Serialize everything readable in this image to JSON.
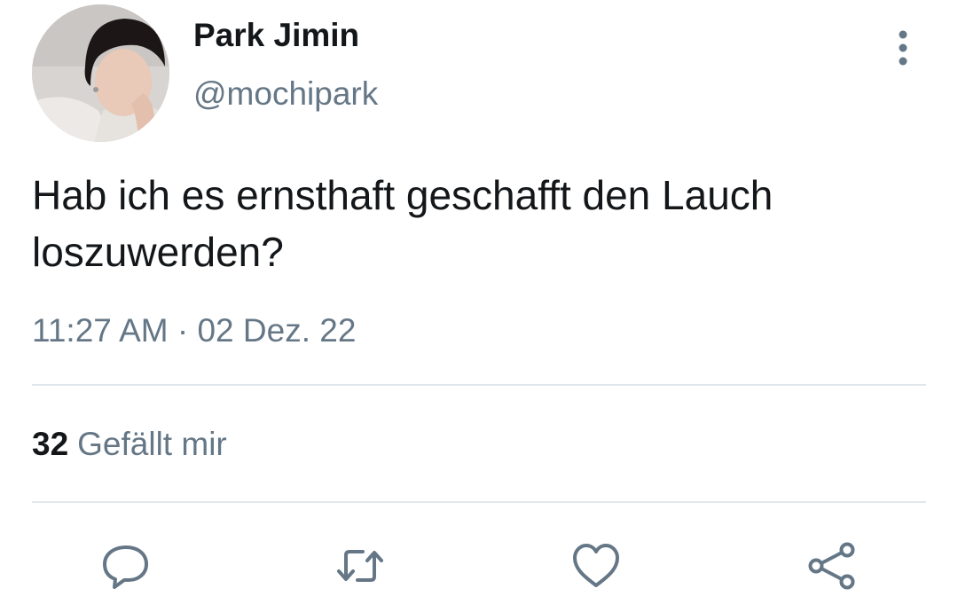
{
  "user": {
    "display_name": "Park Jimin",
    "handle": "@mochipark",
    "avatar": "profile-photo"
  },
  "tweet": {
    "text": "Hab ich es ernsthaft geschafft den Lauch loszuwerden?",
    "timestamp": "11:27 AM · 02 Dez. 22"
  },
  "stats": {
    "likes_count": "32",
    "likes_label": "Gefällt mir"
  },
  "actions": [
    {
      "icon": "reply-icon"
    },
    {
      "icon": "retweet-icon"
    },
    {
      "icon": "heart-icon"
    },
    {
      "icon": "share-icon"
    }
  ],
  "colors": {
    "text_primary": "#14171a",
    "text_secondary": "#657786",
    "divider": "#e1e8ed",
    "background": "#ffffff"
  }
}
